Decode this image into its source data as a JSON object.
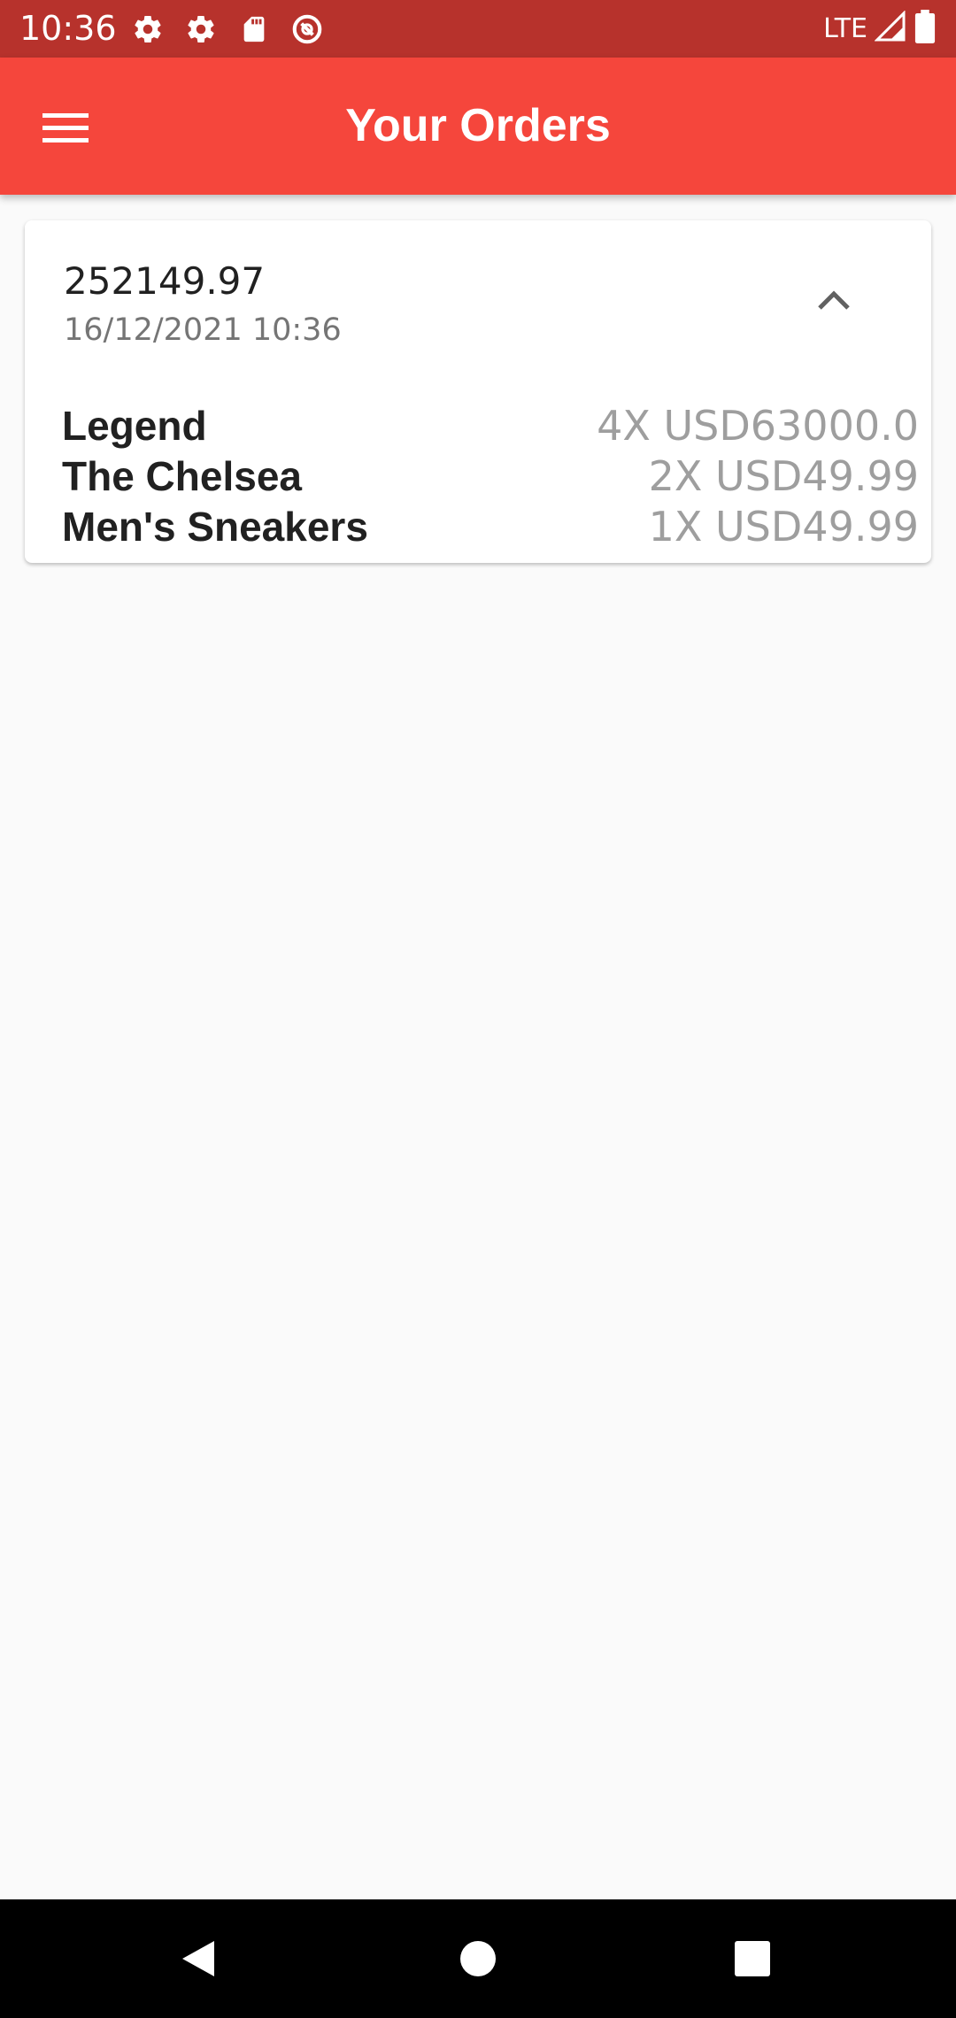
{
  "status_bar": {
    "time": "10:36",
    "network": "LTE",
    "icons": [
      "settings-icon",
      "settings-icon",
      "sd-card-icon",
      "do-not-disturb-icon",
      "signal-icon",
      "battery-icon"
    ]
  },
  "app_bar": {
    "title": "Your Orders",
    "menu_icon": "hamburger-menu-icon",
    "background_color": "#f5463c"
  },
  "order": {
    "total": "252149.97",
    "date": "16/12/2021 10:36",
    "expand_icon": "chevron-up-icon",
    "items": [
      {
        "name": "Legend",
        "qty_price": "4X USD63000.0"
      },
      {
        "name": "The Chelsea",
        "qty_price": "2X USD49.99"
      },
      {
        "name": "Men's Sneakers",
        "qty_price": "1X USD49.99"
      }
    ]
  },
  "nav_bar": {
    "icons": [
      "back-icon",
      "home-icon",
      "recents-icon"
    ]
  }
}
